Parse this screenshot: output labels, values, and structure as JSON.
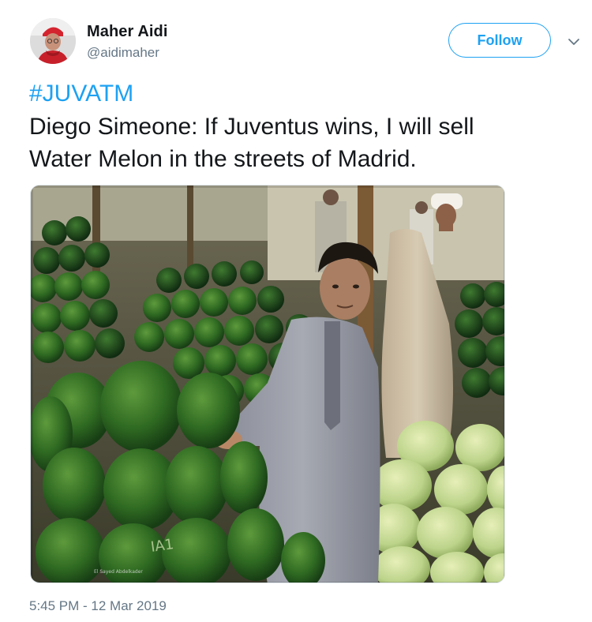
{
  "author": {
    "display_name": "Maher Aidi",
    "handle": "@aidimaher",
    "avatar_icon": "user-avatar"
  },
  "actions": {
    "follow_label": "Follow",
    "more_icon": "chevron-down-icon"
  },
  "tweet": {
    "hashtag": "#JUVATM",
    "text_line_1": "Diego Simeone: If Juventus wins, I will sell",
    "text_line_2": "Water Melon in the streets of Madrid.",
    "media": {
      "kind": "photo",
      "watermark": "El Sayed Abdelkader",
      "sign_text": "IA1"
    },
    "timestamp": "5:45 PM - 12 Mar 2019"
  },
  "colors": {
    "accent": "#1da1f2",
    "text": "#14171a",
    "secondary_text": "#657786"
  }
}
